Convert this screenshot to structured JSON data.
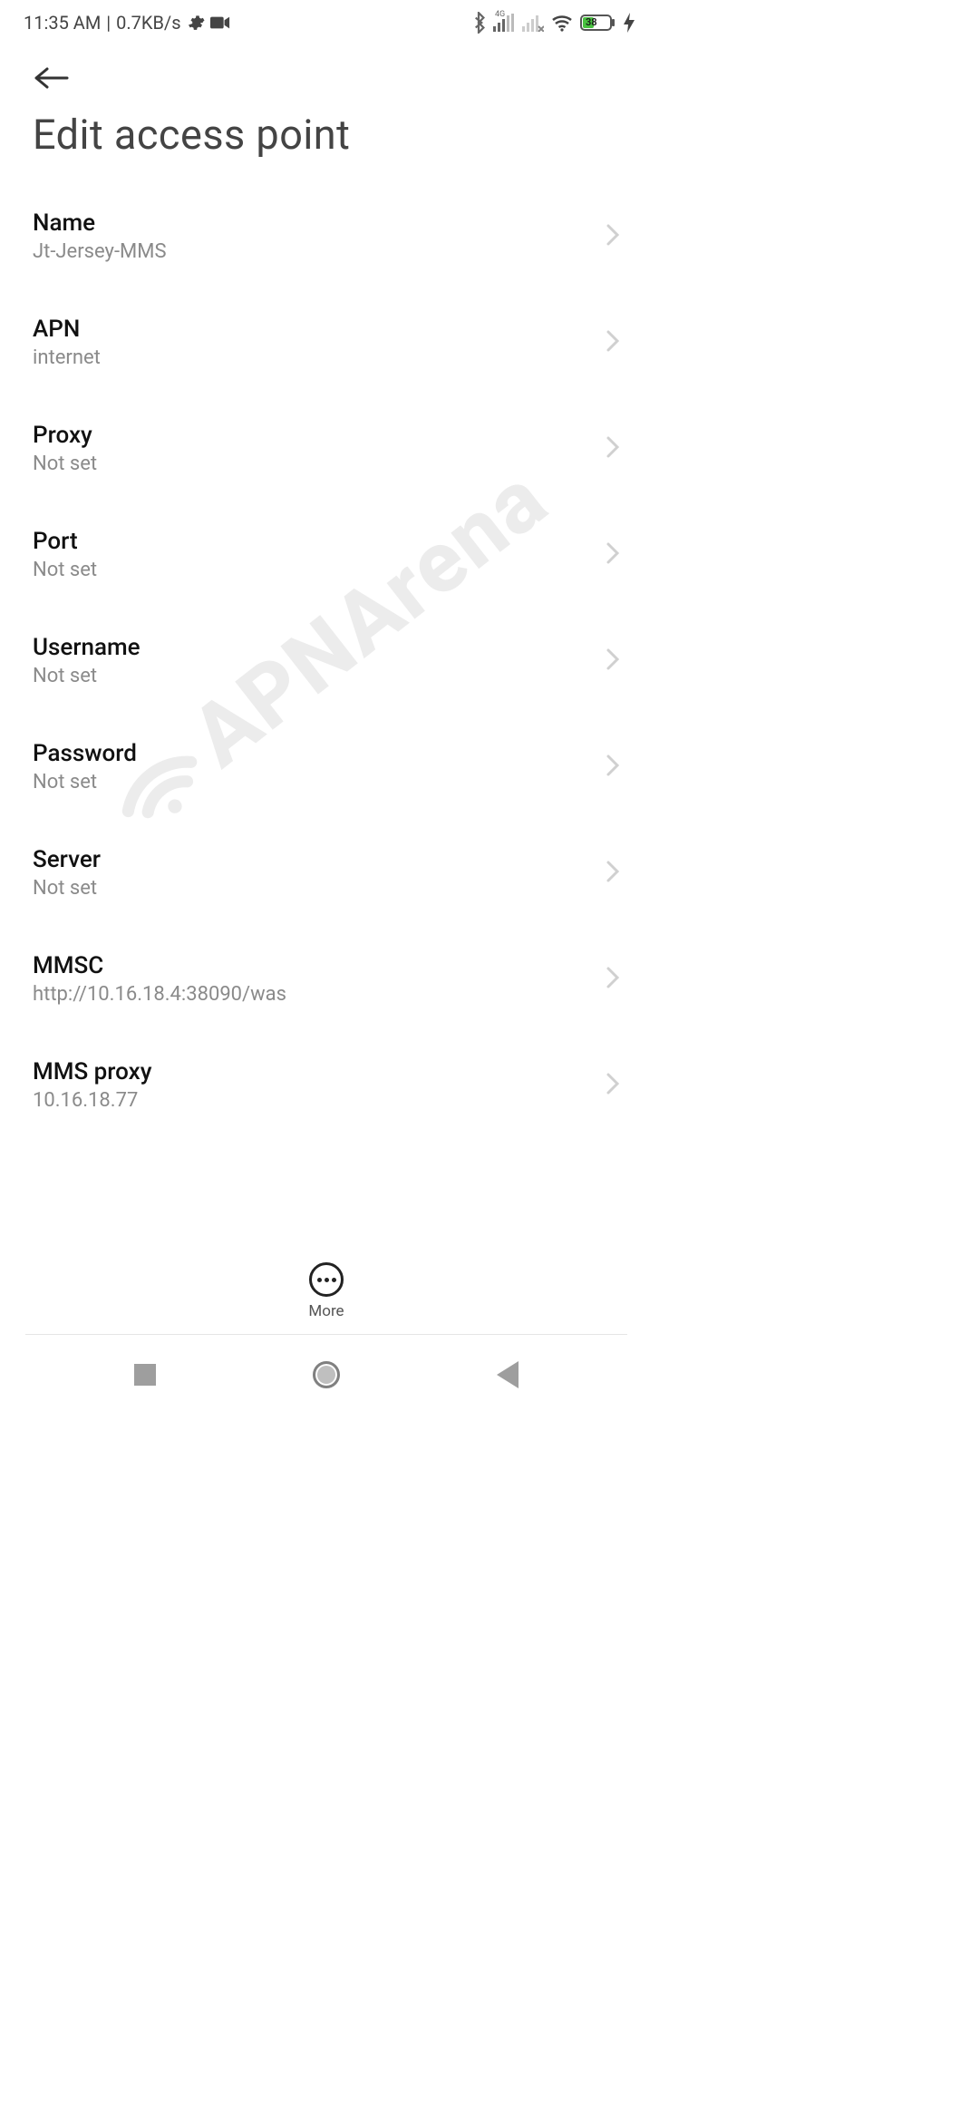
{
  "status": {
    "time": "11:35 AM",
    "speed": "0.7KB/s",
    "net_label": "4G",
    "battery_pct": "38"
  },
  "page": {
    "title": "Edit access point"
  },
  "settings": [
    {
      "label": "Name",
      "value": "Jt-Jersey-MMS"
    },
    {
      "label": "APN",
      "value": "internet"
    },
    {
      "label": "Proxy",
      "value": "Not set"
    },
    {
      "label": "Port",
      "value": "Not set"
    },
    {
      "label": "Username",
      "value": "Not set"
    },
    {
      "label": "Password",
      "value": "Not set"
    },
    {
      "label": "Server",
      "value": "Not set"
    },
    {
      "label": "MMSC",
      "value": "http://10.16.18.4:38090/was"
    },
    {
      "label": "MMS proxy",
      "value": "10.16.18.77"
    }
  ],
  "more_label": "More",
  "watermark": "APNArena"
}
